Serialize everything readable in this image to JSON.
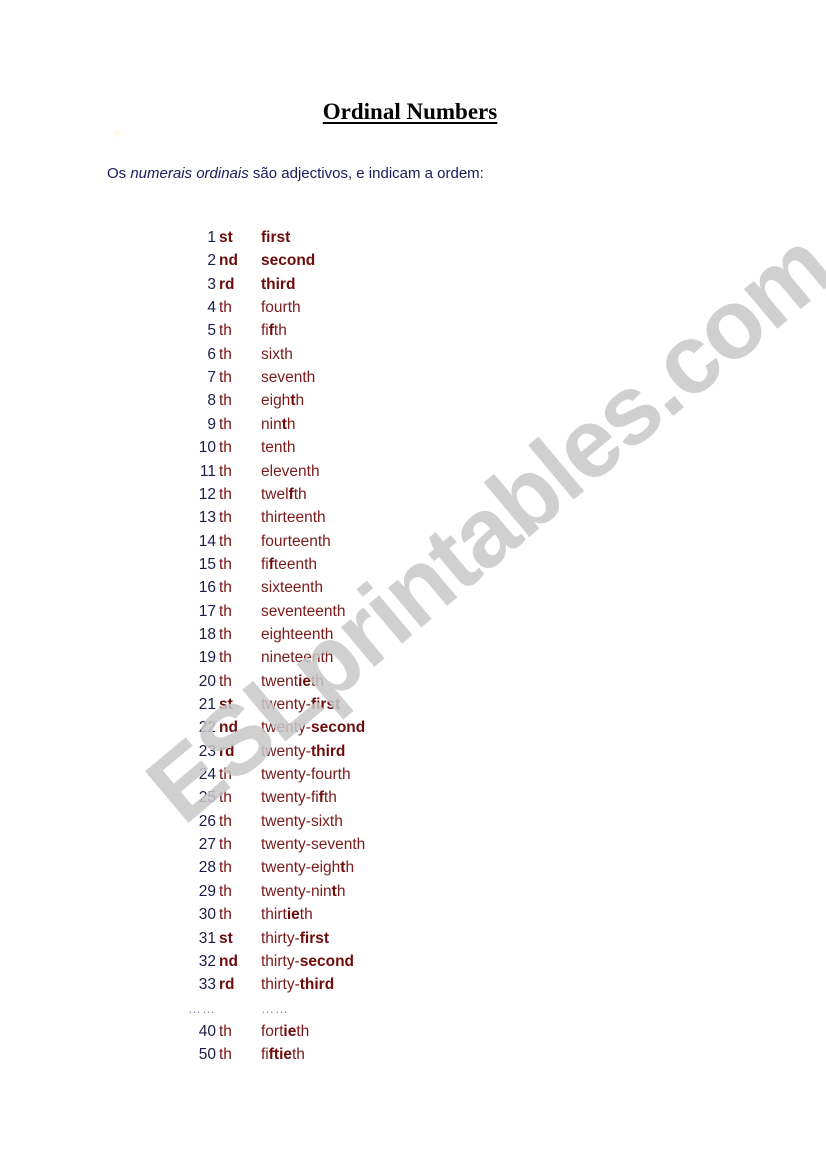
{
  "title": "Ordinal Numbers",
  "intro": {
    "before": "Os ",
    "italic": "numerais ordinais",
    "after": " são adjectivos, e indicam a ordem:"
  },
  "watermark": "ESLprintables.com",
  "colors": {
    "number": "#1c1c4e",
    "suffix": "#7a1212",
    "word": "#7a1a1a",
    "emphasis": "#6e0b0b",
    "watermark": "#c8c8c8"
  },
  "rows": [
    {
      "num": "1",
      "suffix": "st",
      "suffix_bold": true,
      "parts": [
        {
          "t": "first",
          "b": true
        }
      ]
    },
    {
      "num": "2",
      "suffix": "nd",
      "suffix_bold": true,
      "parts": [
        {
          "t": "second",
          "b": true
        }
      ]
    },
    {
      "num": "3",
      "suffix": "rd",
      "suffix_bold": true,
      "parts": [
        {
          "t": "third",
          "b": true
        }
      ]
    },
    {
      "num": "4",
      "suffix": "th",
      "suffix_bold": false,
      "parts": [
        {
          "t": "fourth",
          "b": false
        }
      ]
    },
    {
      "num": "5",
      "suffix": "th",
      "suffix_bold": false,
      "parts": [
        {
          "t": "fi",
          "b": false
        },
        {
          "t": "f",
          "b": true
        },
        {
          "t": "th",
          "b": false
        }
      ]
    },
    {
      "num": "6",
      "suffix": "th",
      "suffix_bold": false,
      "parts": [
        {
          "t": "sixth",
          "b": false
        }
      ]
    },
    {
      "num": "7",
      "suffix": "th",
      "suffix_bold": false,
      "parts": [
        {
          "t": "seventh",
          "b": false
        }
      ]
    },
    {
      "num": "8",
      "suffix": "th",
      "suffix_bold": false,
      "parts": [
        {
          "t": "eigh",
          "b": false
        },
        {
          "t": "t",
          "b": true
        },
        {
          "t": "h",
          "b": false
        }
      ]
    },
    {
      "num": "9",
      "suffix": "th",
      "suffix_bold": false,
      "parts": [
        {
          "t": "nin",
          "b": false
        },
        {
          "t": "t",
          "b": true
        },
        {
          "t": "h",
          "b": false
        }
      ]
    },
    {
      "num": "10",
      "suffix": "th",
      "suffix_bold": false,
      "parts": [
        {
          "t": "tenth",
          "b": false
        }
      ]
    },
    {
      "num": "11",
      "suffix": "th",
      "suffix_bold": false,
      "parts": [
        {
          "t": "eleventh",
          "b": false
        }
      ]
    },
    {
      "num": "12",
      "suffix": "th",
      "suffix_bold": false,
      "parts": [
        {
          "t": "twel",
          "b": false
        },
        {
          "t": "f",
          "b": true
        },
        {
          "t": "th",
          "b": false
        }
      ]
    },
    {
      "num": "13",
      "suffix": "th",
      "suffix_bold": false,
      "parts": [
        {
          "t": "thirteenth",
          "b": false
        }
      ]
    },
    {
      "num": "14",
      "suffix": "th",
      "suffix_bold": false,
      "parts": [
        {
          "t": "fourteenth",
          "b": false
        }
      ]
    },
    {
      "num": "15",
      "suffix": "th",
      "suffix_bold": false,
      "parts": [
        {
          "t": "fi",
          "b": false
        },
        {
          "t": "f",
          "b": true
        },
        {
          "t": "teenth",
          "b": false
        }
      ]
    },
    {
      "num": "16",
      "suffix": "th",
      "suffix_bold": false,
      "parts": [
        {
          "t": "sixteenth",
          "b": false
        }
      ]
    },
    {
      "num": "17",
      "suffix": "th",
      "suffix_bold": false,
      "parts": [
        {
          "t": "seventeenth",
          "b": false
        }
      ]
    },
    {
      "num": "18",
      "suffix": "th",
      "suffix_bold": false,
      "parts": [
        {
          "t": "eighteenth",
          "b": false
        }
      ]
    },
    {
      "num": "19",
      "suffix": "th",
      "suffix_bold": false,
      "parts": [
        {
          "t": "nineteenth",
          "b": false
        }
      ]
    },
    {
      "num": "20",
      "suffix": "th",
      "suffix_bold": false,
      "parts": [
        {
          "t": "twent",
          "b": false
        },
        {
          "t": "ie",
          "b": true
        },
        {
          "t": "th",
          "b": false
        }
      ]
    },
    {
      "num": "21",
      "suffix": "st",
      "suffix_bold": true,
      "parts": [
        {
          "t": "twenty-",
          "b": false
        },
        {
          "t": "first",
          "b": true
        }
      ]
    },
    {
      "num": "22",
      "suffix": "nd",
      "suffix_bold": true,
      "parts": [
        {
          "t": "twenty-",
          "b": false
        },
        {
          "t": "second",
          "b": true
        }
      ]
    },
    {
      "num": "23",
      "suffix": "rd",
      "suffix_bold": true,
      "parts": [
        {
          "t": "twenty-",
          "b": false
        },
        {
          "t": "third",
          "b": true
        }
      ]
    },
    {
      "num": "24",
      "suffix": "th",
      "suffix_bold": false,
      "parts": [
        {
          "t": "twenty-fourth",
          "b": false
        }
      ]
    },
    {
      "num": "25",
      "suffix": "th",
      "suffix_bold": false,
      "parts": [
        {
          "t": "twenty-fi",
          "b": false
        },
        {
          "t": "f",
          "b": true
        },
        {
          "t": "th",
          "b": false
        }
      ]
    },
    {
      "num": "26",
      "suffix": "th",
      "suffix_bold": false,
      "parts": [
        {
          "t": "twenty-sixth",
          "b": false
        }
      ]
    },
    {
      "num": "27",
      "suffix": "th",
      "suffix_bold": false,
      "parts": [
        {
          "t": "twenty-seventh",
          "b": false
        }
      ]
    },
    {
      "num": "28",
      "suffix": "th",
      "suffix_bold": false,
      "parts": [
        {
          "t": "twenty-eigh",
          "b": false
        },
        {
          "t": "t",
          "b": true
        },
        {
          "t": "h",
          "b": false
        }
      ]
    },
    {
      "num": "29",
      "suffix": "th",
      "suffix_bold": false,
      "parts": [
        {
          "t": "twenty-nin",
          "b": false
        },
        {
          "t": "t",
          "b": true
        },
        {
          "t": "h",
          "b": false
        }
      ]
    },
    {
      "num": "30",
      "suffix": "th",
      "suffix_bold": false,
      "parts": [
        {
          "t": "thirt",
          "b": false
        },
        {
          "t": "ie",
          "b": true
        },
        {
          "t": "th",
          "b": false
        }
      ]
    },
    {
      "num": "31",
      "suffix": "st",
      "suffix_bold": true,
      "parts": [
        {
          "t": "thirty-",
          "b": false
        },
        {
          "t": "first",
          "b": true
        }
      ]
    },
    {
      "num": "32",
      "suffix": "nd",
      "suffix_bold": true,
      "parts": [
        {
          "t": "thirty-",
          "b": false
        },
        {
          "t": "second",
          "b": true
        }
      ]
    },
    {
      "num": "33",
      "suffix": "rd",
      "suffix_bold": true,
      "parts": [
        {
          "t": "thirty-",
          "b": false
        },
        {
          "t": "third",
          "b": true
        }
      ]
    },
    {
      "num": "……",
      "suffix": "",
      "suffix_bold": false,
      "ellipsis": true,
      "parts": [
        {
          "t": "……",
          "b": false
        }
      ]
    },
    {
      "num": "40",
      "suffix": "th",
      "suffix_bold": false,
      "parts": [
        {
          "t": "fort",
          "b": false
        },
        {
          "t": "ie",
          "b": true
        },
        {
          "t": "th",
          "b": false
        }
      ]
    },
    {
      "num": "50",
      "suffix": "th",
      "suffix_bold": false,
      "parts": [
        {
          "t": "fi",
          "b": false
        },
        {
          "t": "ftie",
          "b": true
        },
        {
          "t": "th",
          "b": false
        }
      ]
    }
  ]
}
